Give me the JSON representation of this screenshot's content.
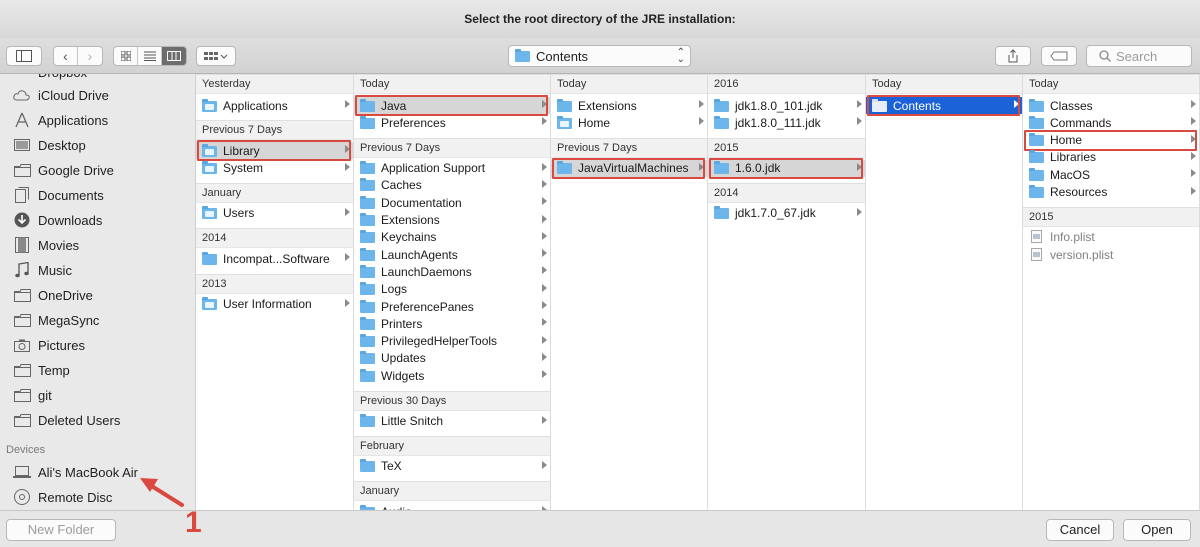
{
  "window": {
    "title": "Select the root directory of the JRE installation:"
  },
  "toolbar": {
    "path_label": "Contents",
    "search_placeholder": "Search"
  },
  "sidebar": {
    "cut_item": "Dropbox",
    "items": [
      {
        "label": "iCloud Drive",
        "icon": "cloud-icon"
      },
      {
        "label": "Applications",
        "icon": "applications-icon"
      },
      {
        "label": "Desktop",
        "icon": "desktop-icon"
      },
      {
        "label": "Google Drive",
        "icon": "folder-icon"
      },
      {
        "label": "Documents",
        "icon": "documents-icon"
      },
      {
        "label": "Downloads",
        "icon": "downloads-icon"
      },
      {
        "label": "Movies",
        "icon": "movies-icon"
      },
      {
        "label": "Music",
        "icon": "music-icon"
      },
      {
        "label": "OneDrive",
        "icon": "folder-icon"
      },
      {
        "label": "MegaSync",
        "icon": "folder-icon"
      },
      {
        "label": "Pictures",
        "icon": "camera-icon"
      },
      {
        "label": "Temp",
        "icon": "folder-icon"
      },
      {
        "label": "git",
        "icon": "folder-icon"
      },
      {
        "label": "Deleted Users",
        "icon": "folder-icon"
      }
    ],
    "devices_header": "Devices",
    "devices": [
      {
        "label": "Ali's MacBook Air",
        "icon": "laptop-icon"
      },
      {
        "label": "Remote Disc",
        "icon": "disc-icon"
      }
    ]
  },
  "columns": [
    {
      "header": "Yesterday",
      "groups": [
        {
          "rows": [
            {
              "label": "Applications",
              "icon": "applications-folder-icon"
            }
          ]
        },
        {
          "title": "Previous 7 Days",
          "rows": [
            {
              "label": "Library",
              "icon": "library-folder-icon",
              "selected": true,
              "highlight": true
            },
            {
              "label": "System",
              "icon": "system-folder-icon"
            }
          ]
        },
        {
          "title": "January",
          "rows": [
            {
              "label": "Users",
              "icon": "users-folder-icon"
            }
          ]
        },
        {
          "title": "2014",
          "rows": [
            {
              "label": "Incompat...Software"
            }
          ]
        },
        {
          "title": "2013",
          "rows": [
            {
              "label": "User Information",
              "icon": "alias-folder-icon"
            }
          ]
        }
      ]
    },
    {
      "header": "Today",
      "groups": [
        {
          "rows": [
            {
              "label": "Java",
              "selected": true,
              "highlight": true
            },
            {
              "label": "Preferences"
            }
          ]
        },
        {
          "title": "Previous 7 Days",
          "rows": [
            {
              "label": "Application Support"
            },
            {
              "label": "Caches"
            },
            {
              "label": "Documentation"
            },
            {
              "label": "Extensions"
            },
            {
              "label": "Keychains"
            },
            {
              "label": "LaunchAgents"
            },
            {
              "label": "LaunchDaemons"
            },
            {
              "label": "Logs"
            },
            {
              "label": "PreferencePanes"
            },
            {
              "label": "Printers"
            },
            {
              "label": "PrivilegedHelperTools"
            },
            {
              "label": "Updates"
            },
            {
              "label": "Widgets"
            }
          ]
        },
        {
          "title": "Previous 30 Days",
          "rows": [
            {
              "label": "Little Snitch"
            }
          ]
        },
        {
          "title": "February",
          "rows": [
            {
              "label": "TeX"
            }
          ]
        },
        {
          "title": "January",
          "rows": [
            {
              "label": "Audio"
            }
          ]
        }
      ]
    },
    {
      "header": "Today",
      "groups": [
        {
          "rows": [
            {
              "label": "Extensions"
            },
            {
              "label": "Home",
              "icon": "alias-folder-icon"
            }
          ]
        },
        {
          "title": "Previous 7 Days",
          "rows": [
            {
              "label": "JavaVirtualMachines",
              "selected": true,
              "highlight": true
            }
          ]
        }
      ]
    },
    {
      "header": "2016",
      "groups": [
        {
          "rows": [
            {
              "label": "jdk1.8.0_101.jdk"
            },
            {
              "label": "jdk1.8.0_111.jdk"
            }
          ]
        },
        {
          "title": "2015",
          "rows": [
            {
              "label": "1.6.0.jdk",
              "selected": true,
              "highlight": true
            }
          ]
        },
        {
          "title": "2014",
          "rows": [
            {
              "label": "jdk1.7.0_67.jdk"
            }
          ]
        }
      ]
    },
    {
      "header": "Today",
      "groups": [
        {
          "rows": [
            {
              "label": "Contents",
              "selected_blue": true,
              "highlight": true
            }
          ]
        }
      ]
    },
    {
      "header": "Today",
      "groups": [
        {
          "rows": [
            {
              "label": "Classes"
            },
            {
              "label": "Commands"
            },
            {
              "label": "Home",
              "highlight": true
            },
            {
              "label": "Libraries"
            },
            {
              "label": "MacOS"
            },
            {
              "label": "Resources"
            }
          ]
        },
        {
          "title": "2015",
          "rows": [
            {
              "label": "Info.plist",
              "file": true
            },
            {
              "label": "version.plist",
              "file": true
            }
          ]
        }
      ]
    }
  ],
  "bottombar": {
    "new_folder": "New Folder",
    "cancel": "Cancel",
    "open": "Open"
  },
  "annotation": {
    "label": "1",
    "color": "#d9493f"
  },
  "colors": {
    "selection_blue": "#1b62d8",
    "highlight_red": "#d9493f",
    "folder_blue": "#6cb6ec"
  }
}
